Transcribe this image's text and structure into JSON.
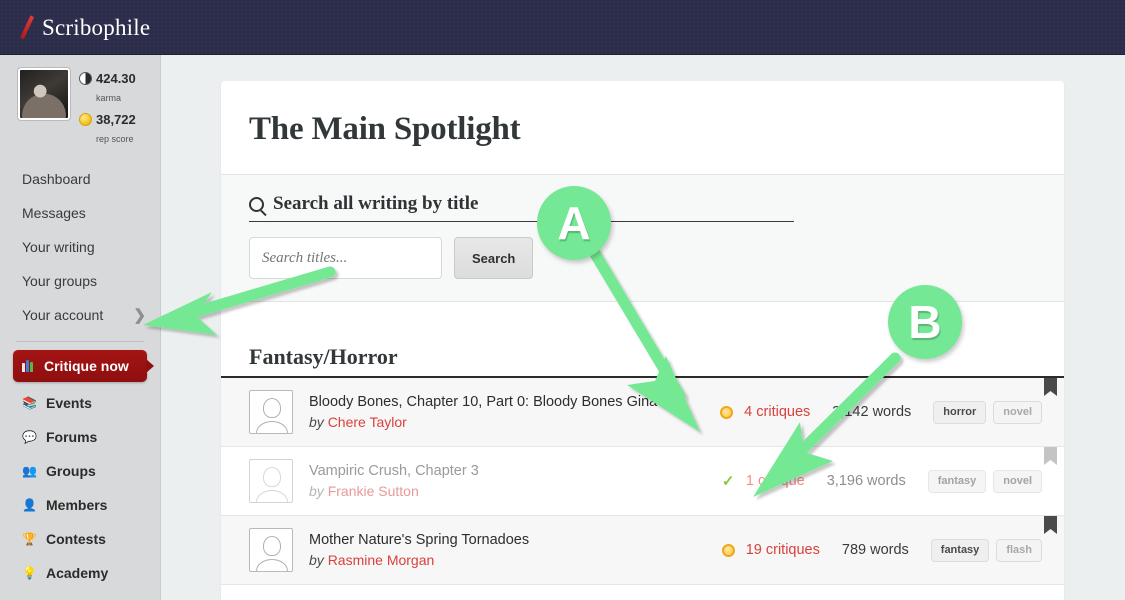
{
  "header": {
    "brand": "Scribophile",
    "logo_icon": "red-slash-icon"
  },
  "sidebar": {
    "user": {
      "avatar_icon": "user-photo-avatar",
      "karma_value": "424.30",
      "karma_label": "karma",
      "karma_icon": "yin-yang-icon",
      "rep_value": "38,722",
      "rep_label": "rep score",
      "rep_icon": "gold-medal-icon"
    },
    "items": [
      {
        "label": "Dashboard",
        "icon": "",
        "chevron": ""
      },
      {
        "label": "Messages",
        "icon": "",
        "chevron": ""
      },
      {
        "label": "Your writing",
        "icon": "",
        "chevron": ""
      },
      {
        "label": "Your groups",
        "icon": "",
        "chevron": ""
      },
      {
        "label": "Your account",
        "icon": "",
        "chevron": "❯"
      }
    ],
    "critique_button": {
      "label": "Critique now",
      "icon": "books-icon",
      "color": "#9c1212"
    },
    "items2": [
      {
        "label": "Events",
        "icon": "📚"
      },
      {
        "label": "Forums",
        "icon": "💬"
      },
      {
        "label": "Groups",
        "icon": "👥"
      },
      {
        "label": "Members",
        "icon": "👤"
      },
      {
        "label": "Contests",
        "icon": "🏆"
      },
      {
        "label": "Academy",
        "icon": "💡"
      }
    ]
  },
  "main": {
    "page_title": "The Main Spotlight",
    "search": {
      "heading": "Search all writing by title",
      "heading_icon": "search-icon",
      "input_placeholder": "Search titles...",
      "input_value": "",
      "button_label": "Search"
    },
    "genre_heading": "Fantasy/Horror",
    "rows": [
      {
        "title": "Bloody Bones, Chapter 10, Part 0: Bloody Bones Gina",
        "by_prefix": "by",
        "author": "Chere Taylor",
        "status_icon": "orange-dot-icon",
        "critiques": "4 critiques",
        "words": "3,142 words",
        "tags": [
          "horror",
          "novel"
        ],
        "bookmark_icon": "bookmark-icon",
        "avatar_icon": "default-user-avatar"
      },
      {
        "title": "Vampiric Crush, Chapter 3",
        "by_prefix": "by",
        "author": "Frankie Sutton",
        "status_icon": "green-check-icon",
        "critiques": "1 critique",
        "words": "3,196 words",
        "tags": [
          "fantasy",
          "novel"
        ],
        "bookmark_icon": "bookmark-icon",
        "avatar_icon": "default-user-avatar"
      },
      {
        "title": "Mother Nature's Spring Tornadoes",
        "by_prefix": "by",
        "author": "Rasmine Morgan",
        "status_icon": "orange-dot-icon",
        "critiques": "19 critiques",
        "words": "789 words",
        "tags": [
          "fantasy",
          "flash"
        ],
        "bookmark_icon": "bookmark-icon",
        "avatar_icon": "default-user-avatar"
      }
    ]
  },
  "annotations": {
    "color": "#74e894",
    "markers": [
      {
        "label": "A"
      },
      {
        "label": "B"
      }
    ]
  }
}
